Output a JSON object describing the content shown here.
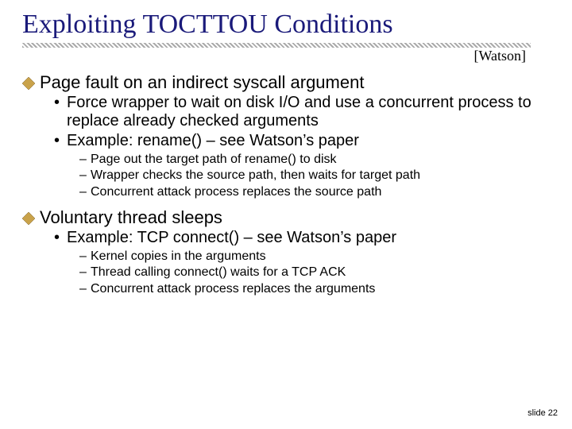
{
  "title": "Exploiting TOCTTOU Conditions",
  "citation": "[Watson]",
  "sec1": {
    "heading": "Page fault on an indirect syscall argument",
    "b1": "Force wrapper to wait on disk I/O and use a concurrent process to replace already checked arguments",
    "b2": "Example: rename() – see Watson’s paper",
    "s1": "Page out the target path of rename() to disk",
    "s2": "Wrapper checks the source path, then waits for target path",
    "s3": "Concurrent attack process replaces the source path"
  },
  "sec2": {
    "heading": "Voluntary thread sleeps",
    "b1": "Example: TCP connect() – see Watson’s paper",
    "s1": "Kernel copies in the arguments",
    "s2": "Thread calling connect() waits for a TCP ACK",
    "s3": "Concurrent attack process replaces the arguments"
  },
  "slidenum": "slide 22"
}
